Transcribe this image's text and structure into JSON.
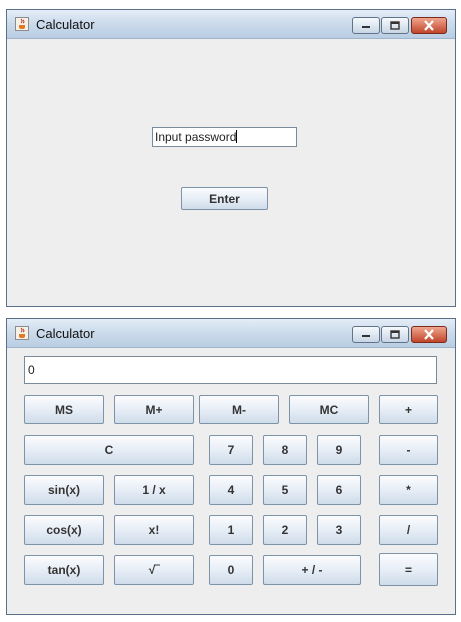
{
  "login_window": {
    "title": "Calculator",
    "password_field": {
      "value": "Input password"
    },
    "enter_label": "Enter"
  },
  "calc_window": {
    "title": "Calculator",
    "display_value": "0",
    "buttons": {
      "ms": "MS",
      "mplus": "M+",
      "mminus": "M-",
      "mc": "MC",
      "plus": "+",
      "clear": "C",
      "seven": "7",
      "eight": "8",
      "nine": "9",
      "minus": "-",
      "sin": "sin(x)",
      "reciprocal": "1 / x",
      "four": "4",
      "five": "5",
      "six": "6",
      "multiply": "*",
      "cos": "cos(x)",
      "factorial": "x!",
      "one": "1",
      "two": "2",
      "three": "3",
      "divide": "/",
      "tan": "tan(x)",
      "sqrt": "√‾",
      "zero": "0",
      "negate": "+ / -",
      "equals": "="
    }
  },
  "icons": {
    "app": "java-cup-icon",
    "minimize": "minimize-icon",
    "maximize": "maximize-icon",
    "close": "close-icon"
  },
  "colors": {
    "titlebar": "#cddcec",
    "window_bg": "#eeeeee",
    "close_button": "#c0452b"
  }
}
